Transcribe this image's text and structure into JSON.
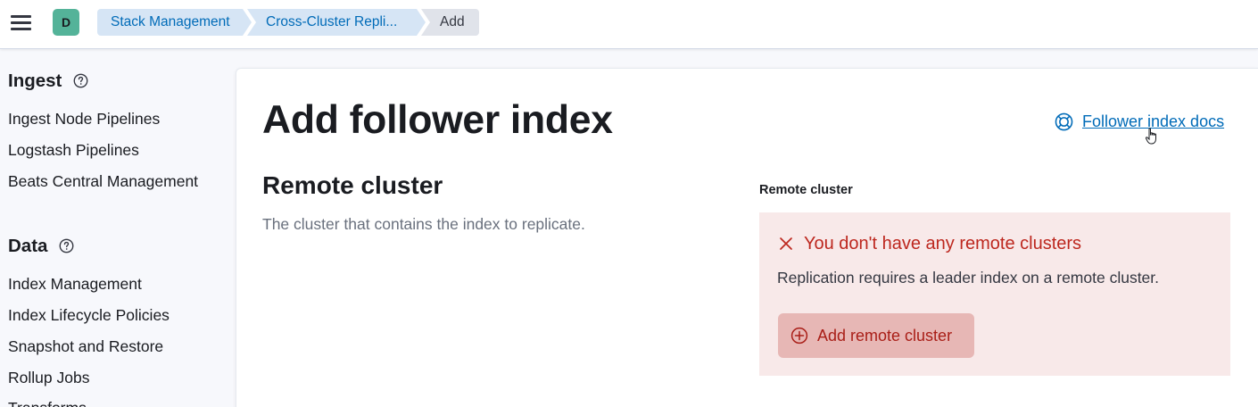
{
  "header": {
    "avatar_letter": "D",
    "breadcrumbs": [
      "Stack Management",
      "Cross-Cluster Repli...",
      "Add"
    ]
  },
  "sidebar": {
    "sections": [
      {
        "title": "Ingest",
        "items": [
          "Ingest Node Pipelines",
          "Logstash Pipelines",
          "Beats Central Management"
        ]
      },
      {
        "title": "Data",
        "items": [
          "Index Management",
          "Index Lifecycle Policies",
          "Snapshot and Restore",
          "Rollup Jobs",
          "Transforms"
        ]
      }
    ]
  },
  "main": {
    "title": "Add follower index",
    "docs_link": "Follower index docs",
    "section_title": "Remote cluster",
    "section_description": "The cluster that contains the index to replicate.",
    "field_label": "Remote cluster",
    "callout": {
      "title": "You don't have any remote clusters",
      "body": "Replication requires a leader index on a remote cluster.",
      "button": "Add remote cluster"
    }
  },
  "colors": {
    "accent": "#006bb8",
    "danger": "#bd271e",
    "callout_bg": "#f8e9e9",
    "avatar": "#54b399"
  }
}
